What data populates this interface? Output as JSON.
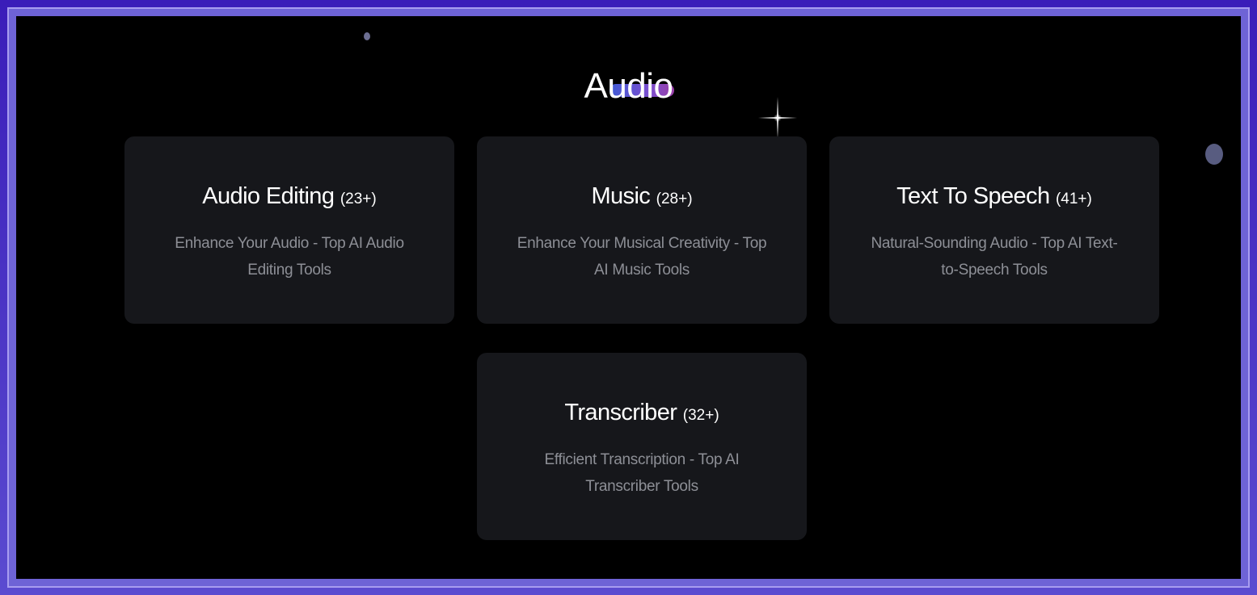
{
  "section": {
    "title": "Audio"
  },
  "categories": [
    {
      "title": "Audio Editing",
      "count": "(23+)",
      "description": "Enhance Your Audio - Top AI Audio Editing Tools"
    },
    {
      "title": "Music",
      "count": "(28+)",
      "description": "Enhance Your Musical Creativity - Top AI Music Tools"
    },
    {
      "title": "Text To Speech",
      "count": "(41+)",
      "description": "Natural-Sounding Audio - Top AI Text-to-Speech Tools"
    },
    {
      "title": "Transcriber",
      "count": "(32+)",
      "description": "Efficient Transcription - Top AI Transcriber Tools"
    }
  ],
  "colors": {
    "background": "#000000",
    "card": "#16171b",
    "frame": "#3a1fb8",
    "accent_gradient_start": "#3f5bd4",
    "accent_gradient_end": "#9a3fa8"
  },
  "icons": [
    "sparkle-icon"
  ]
}
